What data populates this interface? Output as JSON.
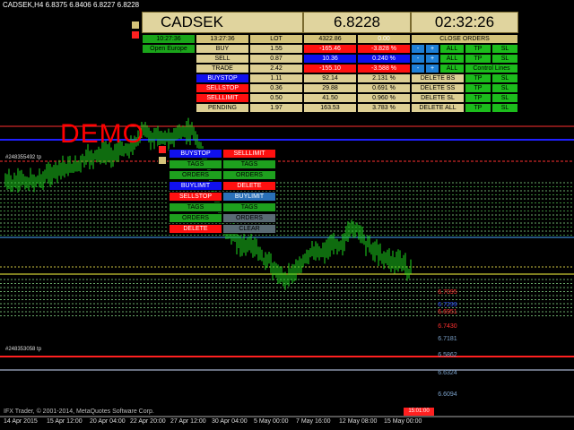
{
  "window": {
    "title": "CADSEK,H4 6.8375 6.8406 6.8227 6.8228"
  },
  "watermark": "DEMO",
  "footer": "IFX Trader, © 2001-2014, MetaQuotes Software Corp.",
  "current_time_label": "15:01:00",
  "time_axis": [
    "14 Apr 2015",
    "15 Apr 12:00",
    "20 Apr 04:00",
    "22 Apr 20:00",
    "27 Apr 12:00",
    "30 Apr 04:00",
    "5 May 00:00",
    "7 May 16:00",
    "12 May 08:00",
    "15 May 00:00"
  ],
  "price_labels": [
    {
      "text": "6.7430",
      "color": "#ff3030"
    },
    {
      "text": "6.7299",
      "color": "#3050ff"
    },
    {
      "text": "6.7095",
      "color": "#ff3030"
    },
    {
      "text": "6.6951",
      "color": "#ff3030"
    },
    {
      "text": "6.7181",
      "color": "#7aa0c8"
    },
    {
      "text": "6.5862",
      "color": "#7aa0c8"
    },
    {
      "text": "6.6324",
      "color": "#7aa0c8"
    },
    {
      "text": "6.6094",
      "color": "#7aa0c8"
    }
  ],
  "order_labels": [
    "#248355492 tp",
    "#248353058 tp"
  ],
  "panel": {
    "symbol": "CADSEK",
    "price": "6.8228",
    "clock": "02:32:26",
    "server_time": "10:27:36",
    "local_time": "13:27:36",
    "session": "Open Europe",
    "col_lot": "LOT",
    "balance": "4322.86",
    "zero": "0.00",
    "close_orders": "CLOSE ORDERS",
    "rows": [
      {
        "label": "BUY",
        "lot": "1.55",
        "profit": "-165.46",
        "pct": "-3.828 %"
      },
      {
        "label": "SELL",
        "lot": "0.87",
        "profit": "10.36",
        "pct": "0.240 %"
      },
      {
        "label": "TRADE",
        "lot": "2.42",
        "profit": "-155.10",
        "pct": "-3.588 %"
      },
      {
        "label": "BUYSTOP",
        "lot": "1.11",
        "profit": "92.14",
        "pct": "2.131 %"
      },
      {
        "label": "SELLSTOP",
        "lot": "0.36",
        "profit": "29.88",
        "pct": "0.691 %"
      },
      {
        "label": "SELLLIMIT",
        "lot": "0.50",
        "profit": "41.50",
        "pct": "0.960 %"
      },
      {
        "label": "PENDING",
        "lot": "1.97",
        "profit": "163.53",
        "pct": "3.783 %"
      }
    ],
    "minus": "-",
    "plus": "+",
    "all": "ALL",
    "tp": "TP",
    "sl": "SL",
    "control_lines": "Control Lines",
    "delete_bs": "DELETE BS",
    "delete_ss": "DELETE SS",
    "delete_sl": "DELETE SL",
    "delete_all": "DELETE ALL"
  },
  "mini_panel": {
    "buystop": "BUYSTOP",
    "selllimit": "SELLLIMIT",
    "tags": "TAGS",
    "orders": "ORDERS",
    "buylimit": "BUYLIMIT",
    "delete": "DELETE",
    "sellstop": "SELLSTOP",
    "clear": "CLEAR"
  }
}
